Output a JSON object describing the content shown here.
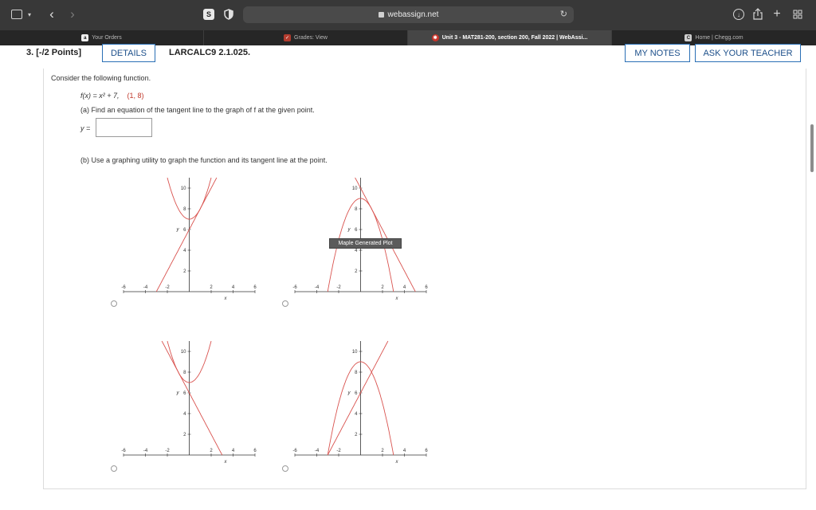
{
  "browser": {
    "url": "webassign.net",
    "tabs": [
      {
        "label": "Your Orders",
        "favicon": "a"
      },
      {
        "label": "Grades: View",
        "favicon": "grades-icon"
      },
      {
        "label": "Unit 3 - MAT281-200, section 200, Fall 2022 | WebAssi...",
        "favicon": "webassign-icon"
      },
      {
        "label": "Home | Chegg.com",
        "favicon": "C"
      }
    ],
    "shield_letter": "S"
  },
  "question": {
    "number": "3.",
    "points": "[-/2 Points]",
    "details_label": "DETAILS",
    "reference": "LARCALC9 2.1.025.",
    "my_notes_label": "MY NOTES",
    "ask_teacher_label": "ASK YOUR TEACHER",
    "intro": "Consider the following function.",
    "function_text": "f(x) = x² + 7,",
    "point_text": "(1, 8)",
    "part_a": "(a) Find an equation of the tangent line to the graph of f at the given point.",
    "y_label": "y =",
    "answer_value": "",
    "part_b": "(b) Use a graphing utility to graph the function and its tangent line at the point.",
    "tooltip": "Maple Generated Plot"
  },
  "plot_labels": {
    "y": "y",
    "x": "x",
    "xticks": [
      "-6",
      "-4",
      "-2",
      "2",
      "4",
      "6"
    ],
    "yticks": [
      "2",
      "4",
      "6",
      "8",
      "10"
    ]
  },
  "chart_data": [
    {
      "type": "line",
      "option": "A",
      "xlim": [
        -6,
        6
      ],
      "ylim": [
        0,
        11
      ],
      "series": [
        {
          "kind": "curve",
          "a": 1,
          "h": 0,
          "k": 7
        },
        {
          "kind": "line",
          "m": 2,
          "b": 6
        }
      ]
    },
    {
      "type": "line",
      "option": "B",
      "xlim": [
        -6,
        6
      ],
      "ylim": [
        0,
        11
      ],
      "series": [
        {
          "kind": "curve",
          "a": -1,
          "h": 0,
          "k": 9
        },
        {
          "kind": "line",
          "m": -2,
          "b": 10
        }
      ]
    },
    {
      "type": "line",
      "option": "C",
      "xlim": [
        -6,
        6
      ],
      "ylim": [
        0,
        11
      ],
      "series": [
        {
          "kind": "curve",
          "a": 1,
          "h": 0,
          "k": 7
        },
        {
          "kind": "line",
          "m": -2,
          "b": 6
        }
      ]
    },
    {
      "type": "line",
      "option": "D",
      "xlim": [
        -6,
        6
      ],
      "ylim": [
        0,
        11
      ],
      "series": [
        {
          "kind": "curve",
          "a": -1,
          "h": 0,
          "k": 9
        },
        {
          "kind": "line",
          "m": 2,
          "b": 6
        }
      ]
    }
  ],
  "colors": {
    "accent": "#2a6fb5",
    "curve": "#d9534f",
    "toolbar": "#383838",
    "tabbar": "#262626"
  }
}
